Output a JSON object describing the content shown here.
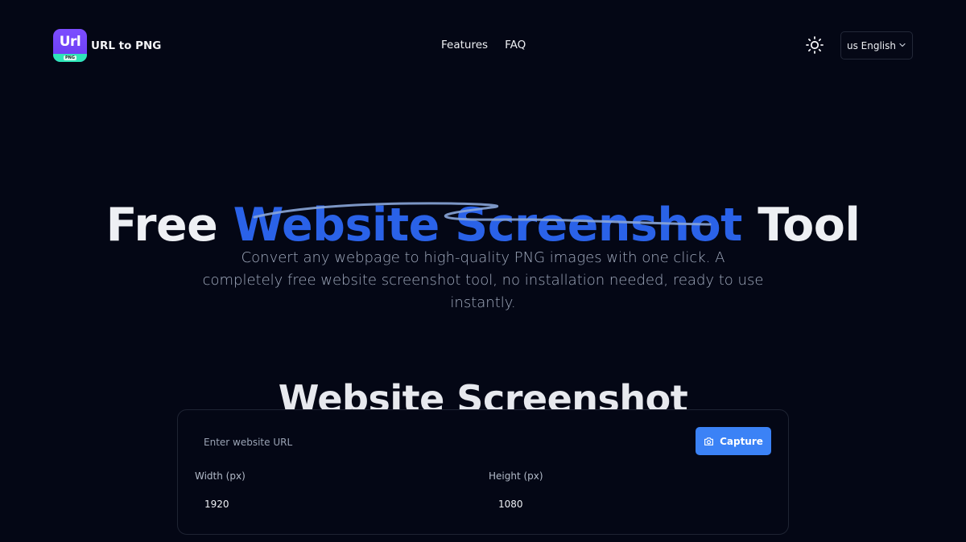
{
  "brand": {
    "logo_text": "Url",
    "logo_badge": "PNG",
    "name": "URL to PNG"
  },
  "nav": {
    "items": [
      {
        "label": "Features"
      },
      {
        "label": "FAQ"
      }
    ]
  },
  "header": {
    "theme_icon": "sun-icon",
    "language": {
      "selected": "us English",
      "icon": "chevron-down-icon"
    }
  },
  "hero": {
    "title_prefix": "Free ",
    "title_accent": "Website Screenshot",
    "title_suffix": " Tool",
    "subtitle": "Convert any webpage to high-quality PNG images with one click. A completely free website screenshot tool, no installation needed, ready to use instantly."
  },
  "tool": {
    "section_title": "Website Screenshot",
    "url_placeholder": "Enter website URL",
    "url_value": "",
    "capture_label": "Capture",
    "capture_icon": "camera-icon",
    "width_label": "Width (px)",
    "width_value": "1920",
    "height_label": "Height (px)",
    "height_value": "1080"
  },
  "colors": {
    "background": "#040715",
    "accent": "#2a62e8",
    "button": "#3b82f6",
    "logo": "#7c4dff",
    "logo_strip": "#2ee6b8"
  }
}
